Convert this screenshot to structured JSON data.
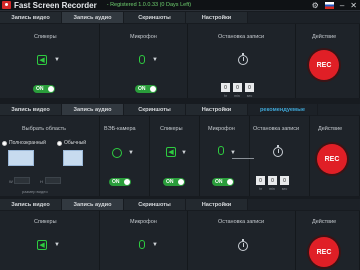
{
  "app": {
    "title": "Fast Screen Recorder",
    "registration": "- Registered 1.0.0.33 (0 Days Left)"
  },
  "tabs": [
    "Запись видео",
    "Запись аудио",
    "Скриншоты",
    "Настройки"
  ],
  "recommended_tab": "рекомендуемые",
  "section1": {
    "headers": [
      "Спикеры",
      "Микрофон",
      "Остановка записи",
      "Действие"
    ],
    "toggle1": "ON",
    "toggle2": "ON",
    "time": [
      "0",
      "0",
      "0"
    ],
    "time_labels": [
      "hr",
      "min",
      "sec"
    ],
    "rec": "REC"
  },
  "section2": {
    "headers": [
      "Выбрать область",
      "ВЭБ-камера",
      "Спикеры",
      "Микрофон",
      "Остановка записи",
      "Действие"
    ],
    "radio_full": "Полноэкранный",
    "radio_normal": "Обычный",
    "size_label": "размер видео",
    "w": "W",
    "h": "H",
    "toggles": [
      "ON",
      "ON",
      "ON"
    ],
    "time": [
      "0",
      "0",
      "0"
    ],
    "time_labels": [
      "hr",
      "min",
      "sec"
    ],
    "rec": "REC"
  },
  "section3": {
    "headers": [
      "Спикеры",
      "Микрофон",
      "Остановка записи",
      "Действие"
    ],
    "rec": "REC"
  },
  "icons": [
    "settings-gear-icon",
    "flag-ru-icon",
    "minimize-icon",
    "close-icon",
    "speaker-icon",
    "microphone-icon",
    "timer-icon",
    "webcam-icon"
  ],
  "colors": {
    "accent_green": "#2ecc40",
    "rec_red": "#e01f26",
    "link_blue": "#3fa8d8"
  }
}
